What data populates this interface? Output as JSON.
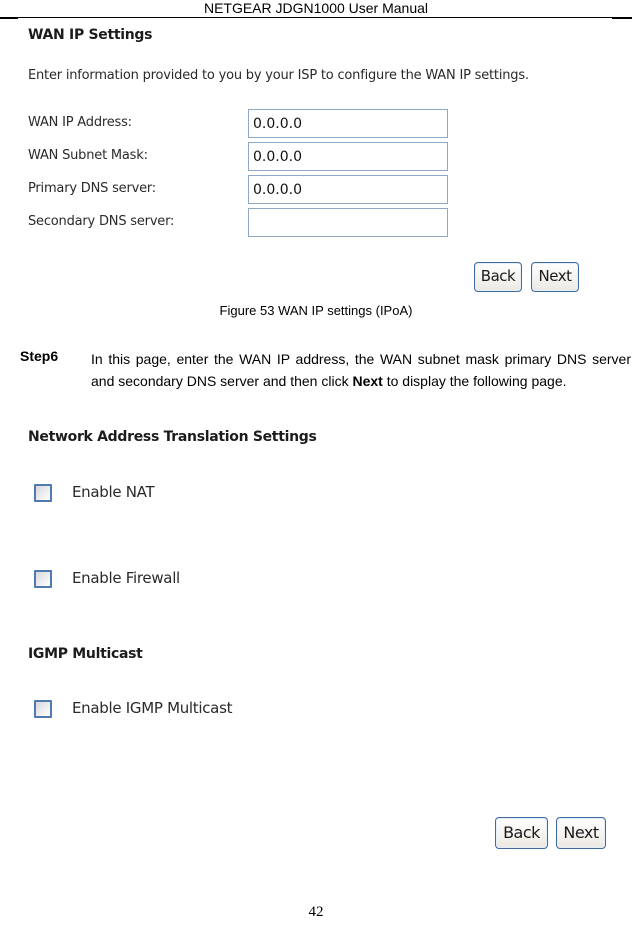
{
  "header": {
    "title": "NETGEAR JDGN1000 User Manual"
  },
  "wan_ip_settings": {
    "title": "WAN IP Settings",
    "description": "Enter information provided to you by your ISP to configure the WAN IP settings.",
    "fields": [
      {
        "label": "WAN IP Address:",
        "value": "0.0.0.0",
        "placeholder": ""
      },
      {
        "label": "WAN Subnet Mask:",
        "value": "0.0.0.0",
        "placeholder": ""
      },
      {
        "label": "Primary DNS server:",
        "value": "0.0.0.0",
        "placeholder": ""
      },
      {
        "label": "Secondary DNS server:",
        "value": "",
        "placeholder": ""
      }
    ],
    "back_label": "Back",
    "next_label": "Next"
  },
  "figure_caption": "Figure 53 WAN IP settings (IPoA)",
  "step": {
    "label": "Step6",
    "text_before": "In this page, enter the WAN IP address, the WAN subnet mask primary DNS server and secondary DNS server and then click ",
    "bold": "Next",
    "text_after": " to display the following page."
  },
  "nat_settings": {
    "title": "Network Address Translation Settings",
    "options": [
      {
        "label": "Enable NAT",
        "checked": false
      },
      {
        "label": "Enable Firewall",
        "checked": false
      }
    ],
    "igmp_title": "IGMP Multicast",
    "igmp_option": {
      "label": "Enable IGMP Multicast",
      "checked": false
    },
    "back_label": "Back",
    "next_label": "Next"
  },
  "footer": {
    "page_number": "42"
  }
}
